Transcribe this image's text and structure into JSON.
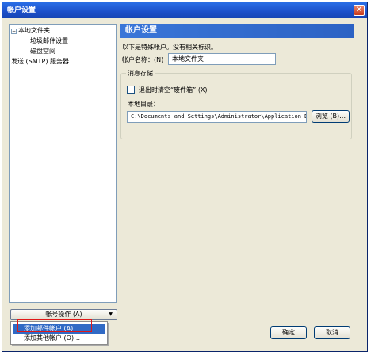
{
  "window": {
    "title": "帐户设置",
    "close_glyph": "✕"
  },
  "tree": {
    "expander": "−",
    "items": [
      "本地文件夹",
      "垃圾邮件设置",
      "磁盘空间",
      "发送 (SMTP) 服务器"
    ]
  },
  "account_actions": {
    "label": "帐号操作 (A)",
    "arrow": "▼",
    "menu": [
      "添加邮件帐户 (A)…",
      "添加其他帐户 (O)…"
    ]
  },
  "panel": {
    "header": "帐户设置",
    "description": "以下是特殊帐户。没有相关标识。",
    "name_label": "帐户名称：(N)",
    "name_value": "本地文件夹",
    "storage": {
      "title": "消息存储",
      "checkbox_label": "退出时清空“废件箱” (X)",
      "checked": false,
      "dir_label": "本地目录：",
      "dir_value": "C:\\Documents and Settings\\Administrator\\Application Da",
      "browse": "浏览 (B)…"
    }
  },
  "buttons": {
    "ok": "确定",
    "cancel": "取消"
  }
}
